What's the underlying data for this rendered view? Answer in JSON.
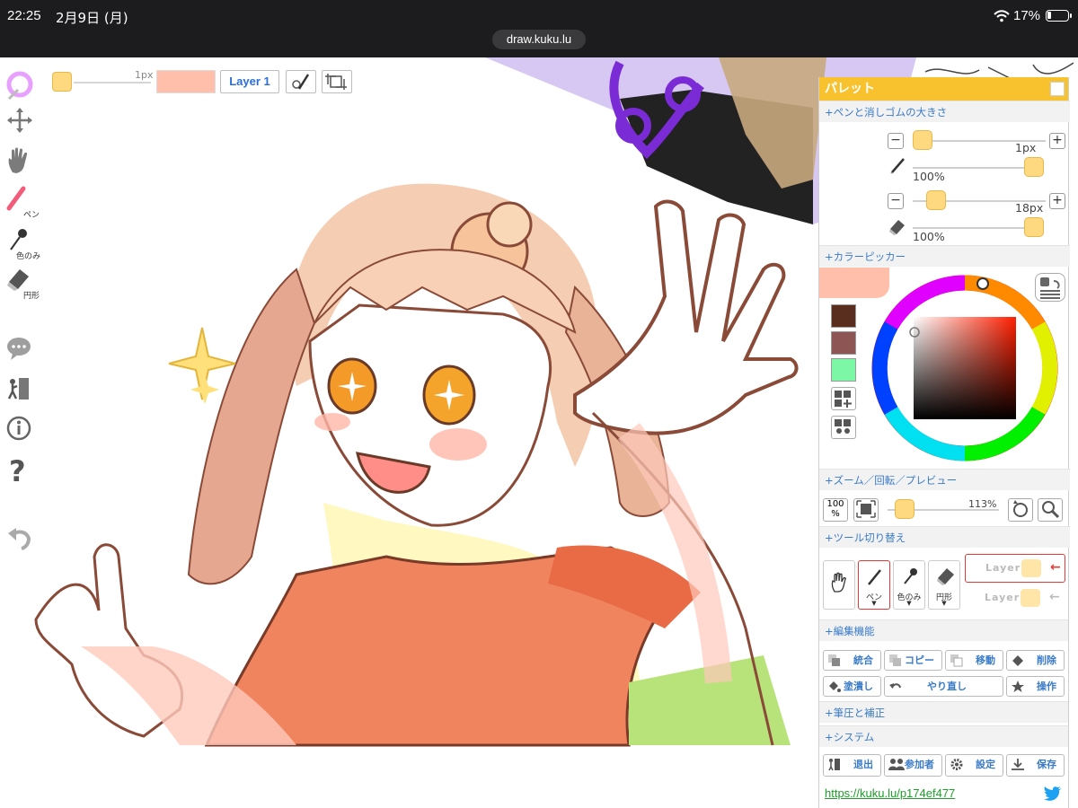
{
  "status_bar": {
    "time": "22:25",
    "date": "2月9日 (月)",
    "battery": "17%",
    "url": "draw.kuku.lu"
  },
  "top_toolbar": {
    "size_label": "1px",
    "current_color": "#ffbfaa",
    "layer_button": "Layer 1"
  },
  "left_toolbar": {
    "items": [
      {
        "icon": "color-wheel-icon",
        "label": ""
      },
      {
        "icon": "move-icon",
        "label": ""
      },
      {
        "icon": "hand-icon",
        "label": ""
      },
      {
        "icon": "pen-icon",
        "label": "ペン"
      },
      {
        "icon": "eyedropper-icon",
        "label": "色のみ"
      },
      {
        "icon": "eraser-icon",
        "label": "円形"
      },
      {
        "icon": "chat-icon",
        "label": ""
      },
      {
        "icon": "exit-icon",
        "label": ""
      },
      {
        "icon": "info-icon",
        "label": ""
      },
      {
        "icon": "help-icon",
        "label": ""
      },
      {
        "icon": "undo-icon",
        "label": ""
      }
    ]
  },
  "palette": {
    "title": "パレット",
    "sections": {
      "size": "+ペンと消しゴムの大きさ",
      "picker": "+カラーピッカー",
      "zoom": "+ズーム／回転／プレビュー",
      "tool_switch": "+ツール切り替え",
      "edit": "+編集機能",
      "pressure": "+筆圧と補正",
      "system": "+システム"
    },
    "pen": {
      "size": "1px",
      "opacity": "100%"
    },
    "eraser": {
      "size": "18px",
      "opacity": "100%"
    },
    "swatches": [
      "#5a2e1e",
      "#8e5555",
      "#7cf7a6"
    ],
    "zoom": {
      "reset_label": "100\n%",
      "value": "113%"
    },
    "tools": [
      {
        "icon": "hand-icon",
        "label": ""
      },
      {
        "icon": "pen-icon",
        "label": "ペン"
      },
      {
        "icon": "eyedropper-icon",
        "label": "色のみ"
      },
      {
        "icon": "eraser-icon",
        "label": "円形"
      }
    ],
    "layers": [
      "Layer1",
      "Layer2"
    ],
    "edit_buttons": [
      "統合",
      "コピー",
      "移動",
      "削除",
      "塗潰し",
      "やり直し",
      "操作"
    ],
    "system_buttons": [
      "退出",
      "参加者",
      "設定",
      "保存"
    ],
    "room_link": "https://kuku.lu/p174ef477"
  }
}
